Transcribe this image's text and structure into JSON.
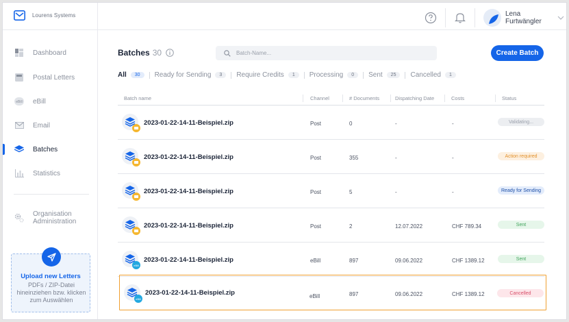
{
  "app": {
    "brand": "Lourens Systems"
  },
  "header": {
    "user_first": "Lena",
    "user_last": "Furtwängler"
  },
  "sidebar": {
    "items": [
      {
        "label": "Dashboard",
        "icon": "dashboard-icon"
      },
      {
        "label": "Postal Letters",
        "icon": "postal-letters-icon"
      },
      {
        "label": "eBill",
        "icon": "ebill-icon"
      },
      {
        "label": "Email",
        "icon": "email-icon"
      },
      {
        "label": "Batches",
        "icon": "batches-icon",
        "active": true
      },
      {
        "label": "Statistics",
        "icon": "statistics-icon"
      }
    ],
    "org_line1": "Organisation",
    "org_line2": "Administration",
    "upload_title": "Upload new Letters",
    "upload_desc": "PDFs / ZIP-Datei hineinziehen bzw. klicken zum Auswählen"
  },
  "main": {
    "title": "Batches",
    "title_count": "30",
    "search_placeholder": "Batch-Name...",
    "create_button": "Create Batch",
    "tabs": [
      {
        "label": "All",
        "count": "30",
        "active": true
      },
      {
        "label": "Ready for Sending",
        "count": "3"
      },
      {
        "label": "Require Credits",
        "count": "1"
      },
      {
        "label": "Processing",
        "count": "0"
      },
      {
        "label": "Sent",
        "count": "25"
      },
      {
        "label": "Cancelled",
        "count": "1"
      }
    ],
    "columns": {
      "name": "Batch name",
      "channel": "Channel",
      "documents": "# Documents",
      "date": "Dispatching Date",
      "costs": "Costs",
      "status": "Status"
    },
    "rows": [
      {
        "name": "2023-01-22-14-11-Beispiel.zip",
        "channel": "Post",
        "documents": "0",
        "date": "-",
        "costs": "-",
        "status": "Validating...",
        "badge": "post"
      },
      {
        "name": "2023-01-22-14-11-Beispiel.zip",
        "channel": "Post",
        "documents": "355",
        "date": "-",
        "costs": "-",
        "status": "Action required",
        "badge": "post"
      },
      {
        "name": "2023-01-22-14-11-Beispiel.zip",
        "channel": "Post",
        "documents": "5",
        "date": "-",
        "costs": "-",
        "status": "Ready for Sending",
        "badge": "post"
      },
      {
        "name": "2023-01-22-14-11-Beispiel.zip",
        "channel": "Post",
        "documents": "2",
        "date": "12.07.2022",
        "costs": "CHF 789.34",
        "status": "Sent",
        "badge": "post"
      },
      {
        "name": "2023-01-22-14-11-Beispiel.zip",
        "channel": "eBill",
        "documents": "897",
        "date": "09.06.2022",
        "costs": "CHF 1389.12",
        "status": "Sent",
        "badge": "ebill"
      },
      {
        "name": "2023-01-22-14-11-Beispiel.zip",
        "channel": "eBill",
        "documents": "897",
        "date": "09.06.2022",
        "costs": "CHF 1389.12",
        "status": "Cancelled",
        "badge": "ebill",
        "selected": true
      }
    ]
  },
  "colors": {
    "accent": "#1565e8",
    "selected_border": "#f0a030",
    "status_validating": "#eceef1",
    "status_action": "#fdf0e0",
    "status_ready": "#e3ecfb",
    "status_sent": "#e6f6ea",
    "status_cancelled": "#fde6ea"
  }
}
